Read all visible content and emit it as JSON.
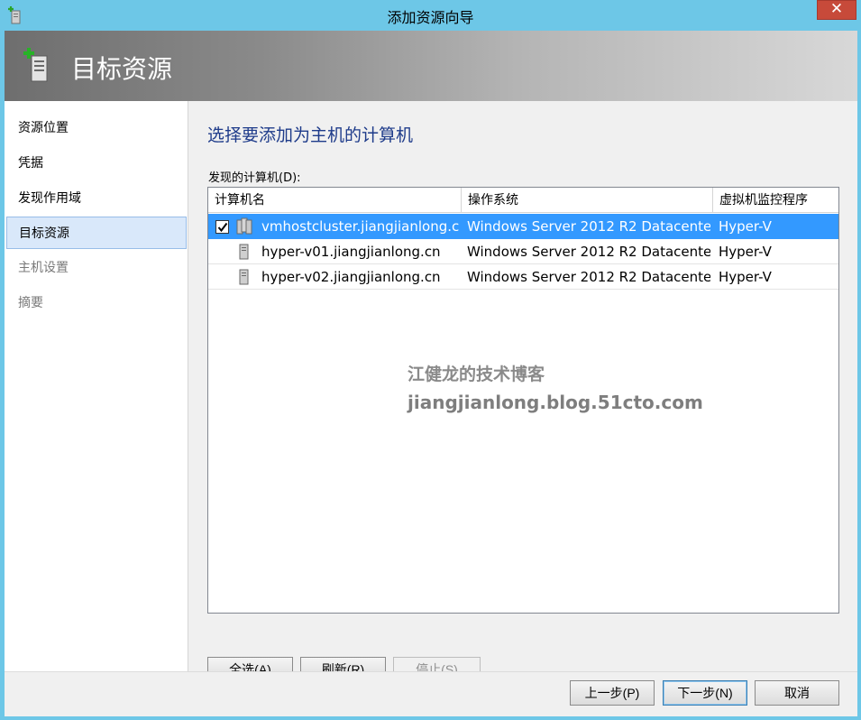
{
  "window": {
    "title": "添加资源向导"
  },
  "header": {
    "title": "目标资源"
  },
  "sidebar": {
    "items": [
      {
        "label": "资源位置",
        "state": "normal"
      },
      {
        "label": "凭据",
        "state": "normal"
      },
      {
        "label": "发现作用域",
        "state": "normal"
      },
      {
        "label": "目标资源",
        "state": "active"
      },
      {
        "label": "主机设置",
        "state": "disabled"
      },
      {
        "label": "摘要",
        "state": "disabled"
      }
    ]
  },
  "main": {
    "heading": "选择要添加为主机的计算机",
    "list_label": "发现的计算机(D):",
    "columns": [
      "计算机名",
      "操作系统",
      "虚拟机监控程序"
    ],
    "rows": [
      {
        "name": "vmhostcluster.jiangjianlong.cn",
        "os": "Windows Server 2012 R2 Datacente...",
        "hypervisor": "Hyper-V",
        "checked": true,
        "icon": "cluster-icon"
      },
      {
        "name": "hyper-v01.jiangjianlong.cn",
        "os": "Windows Server 2012 R2 Datacente...",
        "hypervisor": "Hyper-V",
        "checked": false,
        "icon": "server-icon"
      },
      {
        "name": "hyper-v02.jiangjianlong.cn",
        "os": "Windows Server 2012 R2 Datacente...",
        "hypervisor": "Hyper-V",
        "checked": false,
        "icon": "server-icon"
      }
    ],
    "watermark": {
      "line1": "江健龙的技术博客",
      "line2": "jiangjianlong.blog.51cto.com"
    },
    "buttons": {
      "select_all": "全选(A)",
      "refresh": "刷新(R)",
      "stop": "停止(S)"
    }
  },
  "footer": {
    "prev": "上一步(P)",
    "next": "下一步(N)",
    "cancel": "取消"
  },
  "colors": {
    "titlebar": "#6dc7e7",
    "selection": "#3399ff",
    "heading": "#1e3b8a",
    "close": "#c74a3a"
  }
}
